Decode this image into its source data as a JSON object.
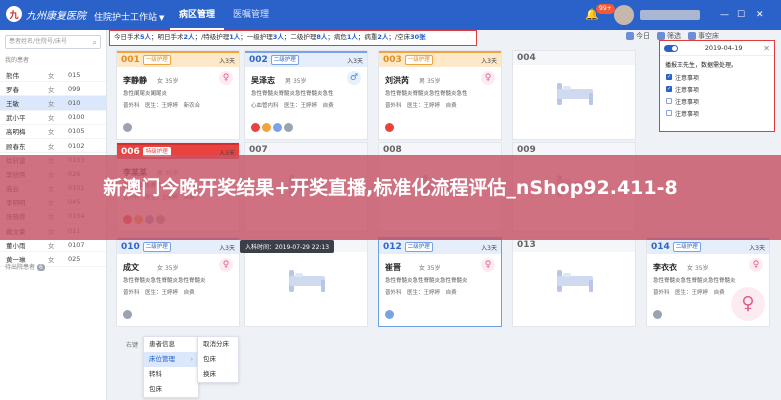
{
  "header": {
    "logo_text": "九州康复医院",
    "logo_mark": "九",
    "workstation": "住院护士工作站",
    "tabs": [
      "病区管理",
      "医嘱管理"
    ],
    "notification_count": "99+",
    "colors": {
      "topbar": "#2a62c9",
      "highlight_box": "#e23b3b"
    }
  },
  "sidebar": {
    "search_placeholder": "患者姓名/住院号/床号",
    "list_header": "我的患者",
    "patients": [
      {
        "name": "熊伟",
        "gender": "女",
        "bed": "015"
      },
      {
        "name": "罗春",
        "gender": "女",
        "bed": "099"
      },
      {
        "name": "王敏",
        "gender": "女",
        "bed": "010"
      },
      {
        "name": "武小平",
        "gender": "女",
        "bed": "0100"
      },
      {
        "name": "高明梅",
        "gender": "女",
        "bed": "0105"
      },
      {
        "name": "顾春东",
        "gender": "女",
        "bed": "0102"
      },
      {
        "name": "徐轩雷",
        "gender": "女",
        "bed": "0103"
      },
      {
        "name": "李锐伟",
        "gender": "女",
        "bed": "026"
      },
      {
        "name": "高云",
        "gender": "女",
        "bed": "0101"
      },
      {
        "name": "李明明",
        "gender": "女",
        "bed": "045"
      },
      {
        "name": "张晓舜",
        "gender": "女",
        "bed": "0104"
      },
      {
        "name": "戴文豪",
        "gender": "女",
        "bed": "011"
      },
      {
        "name": "董小雨",
        "gender": "女",
        "bed": "0107"
      },
      {
        "name": "黄一琳",
        "gender": "女",
        "bed": "025"
      }
    ],
    "selected_index": 2,
    "waiting_label": "待出院患者",
    "waiting_count": "6"
  },
  "summary": {
    "prefix": "今日手术",
    "surgery_today": "5人",
    "t2": "；明日手术",
    "surgery_tomorrow": "2人",
    "t3": "；/特级护理",
    "special": "1人",
    "t4": "；一级护理",
    "level1": "3人",
    "t5": "；二级护理",
    "level2": "8人",
    "t6": "；病危",
    "critical": "1人",
    "t7": "；病重",
    "serious": "2人",
    "t8": "；/空床",
    "empty": "30张"
  },
  "tools": [
    "今日",
    "筛选",
    "",
    "事空床"
  ],
  "beds": [
    {
      "no": "001",
      "care": "一级护理",
      "days": "入3天",
      "style": "orange",
      "name": "李静静",
      "gender": "女",
      "age": "35岁",
      "diag": "急性阑尾炎阑尾炎",
      "doctor": "医生：王婷婷",
      "type": "普外科",
      "status": "新农合",
      "gicon": "♀",
      "dots": [
        "#9aa3b0"
      ]
    },
    {
      "no": "002",
      "care": "二级护理",
      "days": "入3天",
      "style": "blue",
      "name": "吴泽志",
      "gender": "男",
      "age": "35岁",
      "diag": "急性脊髓炎脊髓炎急性脊髓炎急性",
      "doctor": "医生：王婷婷",
      "type": "心血管内科",
      "status": "自费",
      "gicon": "♂",
      "dots": [
        "#e9423f",
        "#f0a43c",
        "#7aa3e6",
        "#9aa3b0"
      ]
    },
    {
      "no": "003",
      "care": "一级护理",
      "days": "入3天",
      "style": "orange",
      "name": "刘洪芮",
      "gender": "男",
      "age": "35岁",
      "diag": "急性脊髓炎脊髓炎急性脊髓炎急性",
      "doctor": "医生：王婷婷",
      "type": "普外科",
      "status": "自费",
      "gicon": "♀",
      "dots": [
        "#e9423f"
      ]
    },
    {
      "no": "004",
      "care": "",
      "days": "",
      "style": "empty"
    },
    {
      "no": "006",
      "care": "特级护理",
      "days": "入3天",
      "style": "red",
      "name": "李某某",
      "gender": "男",
      "age": "35岁",
      "diag": "急性脊髓炎脊髓炎急性",
      "doctor": "医生：王婷婷",
      "type": "普外科",
      "status": "自费",
      "gicon": "",
      "dots": [
        "#e9423f",
        "#f0a43c",
        "#7aa3e6",
        "#9aa3b0"
      ]
    },
    {
      "no": "007",
      "care": "",
      "days": "",
      "style": "empty"
    },
    {
      "no": "008",
      "care": "",
      "days": "",
      "style": "empty"
    },
    {
      "no": "009",
      "care": "",
      "days": "",
      "style": "empty"
    },
    {
      "no": "010",
      "care": "二级护理",
      "days": "入3天",
      "style": "blue",
      "name": "成文",
      "gender": "女",
      "age": "35岁",
      "diag": "急性脊髓炎急性脊髓炎急性脊髓炎",
      "doctor": "医生：王婷婷",
      "type": "普外科",
      "status": "自费",
      "gicon": "♀",
      "dots": [
        "#9aa3b0"
      ]
    },
    {
      "no": "011",
      "care": "",
      "days": "",
      "style": "empty"
    },
    {
      "no": "012",
      "care": "二级护理",
      "days": "入3天",
      "style": "blue",
      "highlight": true,
      "name": "崔晋",
      "gender": "女",
      "age": "35岁",
      "diag": "急性脊髓炎急性脊髓炎急性脊髓炎",
      "doctor": "医生：王婷婷",
      "type": "普外科",
      "status": "自费",
      "gicon": "♀",
      "dots": [
        "#7aa3e6"
      ]
    },
    {
      "no": "013",
      "care": "",
      "days": "",
      "style": "empty"
    },
    {
      "no": "014",
      "care": "二级护理",
      "days": "入3天",
      "style": "blue",
      "name": "李衣衣",
      "gender": "女",
      "age": "35岁",
      "diag": "急性脊髓炎急性脊髓炎急性脊髓炎",
      "doctor": "医生：王婷婷",
      "type": "普外科",
      "status": "自费",
      "gicon": "♀",
      "dots": [
        "#9aa3b0"
      ]
    }
  ],
  "popup": {
    "date": "2019-04-19",
    "close": "✕",
    "greeting": "播报王先生，数据需处理。",
    "todos": [
      {
        "label": "注意事项",
        "checked": true
      },
      {
        "label": "注意事项",
        "checked": true
      },
      {
        "label": "注意事项",
        "checked": false
      },
      {
        "label": "注意事项",
        "checked": false
      }
    ]
  },
  "tooltip": "入科时间：2019-07-29 22:13",
  "context_menu": {
    "label": "右键",
    "col1": [
      {
        "label": "患者信息",
        "arrow": false
      },
      {
        "label": "床位管理",
        "arrow": true
      },
      {
        "label": "转科",
        "arrow": false
      },
      {
        "label": "包床",
        "arrow": false
      }
    ],
    "col2": [
      "取消分床",
      "包床",
      "换床"
    ]
  },
  "banner": {
    "text": "新澳门今晚开奖结果+开奖直播,标准化流程评估_nShop92.411-8"
  }
}
